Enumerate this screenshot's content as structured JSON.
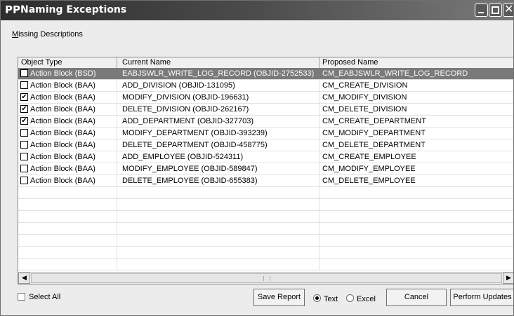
{
  "window": {
    "title": "Naming Exceptions",
    "app_icon": "PP"
  },
  "menu": {
    "label_first": "M",
    "label_rest": "issing Descriptions"
  },
  "table": {
    "headers": [
      "Object Type",
      "Current Name",
      "Proposed Name"
    ],
    "rows": [
      {
        "checked": false,
        "type": "Action Block (BSD)",
        "current": "EABJSWLR_WRITE_LOG_RECORD (OBJID-2752533)",
        "proposed": "CM_EABJSWLR_WRITE_LOG_RECORD",
        "selected": true
      },
      {
        "checked": false,
        "type": "Action Block (BAA)",
        "current": "ADD_DIVISION (OBJID-131095)",
        "proposed": "CM_CREATE_DIVISION",
        "selected": false
      },
      {
        "checked": true,
        "type": "Action Block (BAA)",
        "current": "MODIFY_DIVISION (OBJID-196631)",
        "proposed": "CM_MODIFY_DIVISION",
        "selected": false
      },
      {
        "checked": true,
        "type": "Action Block (BAA)",
        "current": "DELETE_DIVISION (OBJID-262167)",
        "proposed": "CM_DELETE_DIVISION",
        "selected": false
      },
      {
        "checked": true,
        "type": "Action Block (BAA)",
        "current": "ADD_DEPARTMENT (OBJID-327703)",
        "proposed": "CM_CREATE_DEPARTMENT",
        "selected": false
      },
      {
        "checked": false,
        "type": "Action Block (BAA)",
        "current": "MODIFY_DEPARTMENT (OBJID-393239)",
        "proposed": "CM_MODIFY_DEPARTMENT",
        "selected": false
      },
      {
        "checked": false,
        "type": "Action Block (BAA)",
        "current": "DELETE_DEPARTMENT (OBJID-458775)",
        "proposed": "CM_DELETE_DEPARTMENT",
        "selected": false
      },
      {
        "checked": false,
        "type": "Action Block (BAA)",
        "current": "ADD_EMPLOYEE (OBJID-524311)",
        "proposed": "CM_CREATE_EMPLOYEE",
        "selected": false
      },
      {
        "checked": false,
        "type": "Action Block (BAA)",
        "current": "MODIFY_EMPLOYEE (OBJID-589847)",
        "proposed": "CM_MODIFY_EMPLOYEE",
        "selected": false
      },
      {
        "checked": false,
        "type": "Action Block (BAA)",
        "current": "DELETE_EMPLOYEE (OBJID-655383)",
        "proposed": "CM_DELETE_EMPLOYEE",
        "selected": false
      }
    ]
  },
  "footer": {
    "select_all_label": "Select All",
    "select_all_checked": false,
    "save_report_label": "Save Report",
    "format_options": [
      {
        "label": "Text",
        "selected": true
      },
      {
        "label": "Excel",
        "selected": false
      }
    ],
    "cancel_label": "Cancel",
    "perform_updates_label": "Perform Updates"
  },
  "colors": {
    "titlebar_dark": "#2d2d2d",
    "selection": "#7a7a7a",
    "window_bg": "#ececec"
  },
  "icons": [
    "app-icon",
    "minimize-icon",
    "maximize-icon",
    "close-icon",
    "checkbox-icon",
    "scroll-left-icon",
    "scroll-right-icon"
  ]
}
